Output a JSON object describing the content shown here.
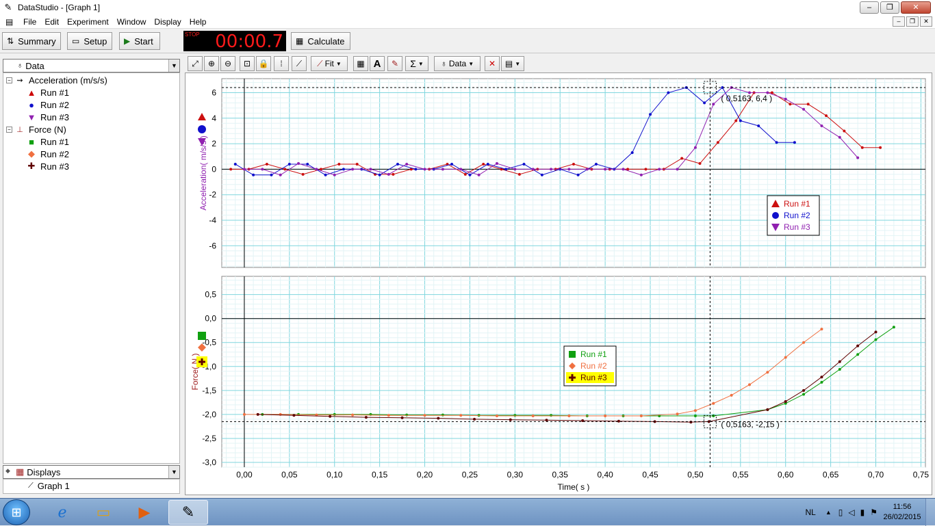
{
  "window": {
    "title": "DataStudio - [Graph 1]",
    "controls": [
      "–",
      "❐",
      "✕"
    ],
    "mdi_controls": [
      "–",
      "❐",
      "✕"
    ]
  },
  "menu": [
    "File",
    "Edit",
    "Experiment",
    "Window",
    "Display",
    "Help"
  ],
  "toolbar": {
    "summary_label": "Summary",
    "setup_label": "Setup",
    "start_label": "Start",
    "timer_stop_label": "STOP",
    "timer_value": "00:00.7",
    "calculate_label": "Calculate"
  },
  "data_panel": {
    "dropdown_label": "Data",
    "tree": [
      {
        "label": "Acceleration (m/s/s)",
        "level": 0,
        "symbol": "accel-sensor-icon"
      },
      {
        "label": "Run #1",
        "level": 1,
        "symbol": "triangle-up",
        "color": "#cc0000"
      },
      {
        "label": "Run #2",
        "level": 1,
        "symbol": "circle",
        "color": "#1010cc"
      },
      {
        "label": "Run #3",
        "level": 1,
        "symbol": "triangle-down",
        "color": "#9020b0"
      },
      {
        "label": "Force (N)",
        "level": 0,
        "symbol": "force-sensor-icon"
      },
      {
        "label": "Run #1",
        "level": 1,
        "symbol": "square",
        "color": "#10a010"
      },
      {
        "label": "Run #2",
        "level": 1,
        "symbol": "diamond",
        "color": "#f07040"
      },
      {
        "label": "Run #3",
        "level": 1,
        "symbol": "plus",
        "color": "#600000"
      }
    ],
    "displays_label": "Displays",
    "displays_items": [
      "Graph 1"
    ]
  },
  "graph_toolbar": {
    "fit_label": "Fit",
    "data_label": "Data"
  },
  "chart_data": [
    {
      "type": "line",
      "title": "",
      "xlabel": "",
      "ylabel": "Acceleration( m/s/s )",
      "xlim": [
        -0.025,
        0.755
      ],
      "ylim": [
        -7.7,
        7.1
      ],
      "yticks": [
        6,
        4,
        2,
        0,
        -2,
        -4,
        -6
      ],
      "legend": "bottom-right",
      "cursor_label": "( 0,5163, 6,4 )",
      "cursor": {
        "x": 0.5163,
        "y": 6.4
      },
      "series": [
        {
          "name": "Run #1",
          "color": "#cc1010",
          "x": [
            -0.015,
            0.005,
            0.025,
            0.045,
            0.065,
            0.085,
            0.105,
            0.125,
            0.145,
            0.165,
            0.185,
            0.205,
            0.225,
            0.245,
            0.265,
            0.285,
            0.305,
            0.325,
            0.345,
            0.365,
            0.385,
            0.405,
            0.425,
            0.445,
            0.465,
            0.485,
            0.505,
            0.525,
            0.545,
            0.565,
            0.585,
            0.605,
            0.625,
            0.645,
            0.665,
            0.685,
            0.705
          ],
          "y": [
            0,
            0,
            0.4,
            0,
            -0.4,
            0,
            0.4,
            0.4,
            -0.4,
            -0.4,
            0,
            0,
            0.4,
            -0.4,
            0.4,
            0,
            -0.4,
            0,
            0,
            0.4,
            0,
            0,
            0,
            0,
            0,
            0.85,
            0.45,
            2.1,
            3.8,
            6,
            6,
            5.1,
            5.1,
            4.2,
            3,
            1.7,
            1.7
          ]
        },
        {
          "name": "Run #2",
          "color": "#1010cc",
          "x": [
            -0.01,
            0.01,
            0.03,
            0.05,
            0.07,
            0.09,
            0.11,
            0.13,
            0.15,
            0.17,
            0.19,
            0.21,
            0.23,
            0.25,
            0.27,
            0.29,
            0.31,
            0.33,
            0.35,
            0.37,
            0.39,
            0.41,
            0.43,
            0.45,
            0.47,
            0.49,
            0.51,
            0.53,
            0.55,
            0.57,
            0.59,
            0.61
          ],
          "y": [
            0.4,
            -0.45,
            -0.45,
            0.4,
            0.4,
            -0.45,
            0,
            0,
            -0.45,
            0.4,
            0,
            0,
            0.4,
            -0.45,
            0.4,
            0,
            0.4,
            -0.45,
            0,
            -0.45,
            0.4,
            0,
            1.3,
            4.3,
            6,
            6.4,
            5.2,
            6.4,
            3.8,
            3.4,
            2.1,
            2.1
          ]
        },
        {
          "name": "Run #3",
          "color": "#9020b0",
          "x": [
            0,
            0.02,
            0.04,
            0.06,
            0.08,
            0.1,
            0.12,
            0.14,
            0.16,
            0.18,
            0.2,
            0.22,
            0.24,
            0.26,
            0.28,
            0.3,
            0.32,
            0.34,
            0.36,
            0.38,
            0.4,
            0.42,
            0.44,
            0.46,
            0.48,
            0.5,
            0.52,
            0.54,
            0.56,
            0.58,
            0.6,
            0.62,
            0.64,
            0.66,
            0.68
          ],
          "y": [
            0,
            0,
            -0.45,
            0.45,
            0,
            -0.45,
            0,
            0,
            -0.4,
            0.4,
            0,
            0,
            0,
            -0.45,
            0.45,
            0,
            0,
            0,
            0,
            0,
            0,
            0,
            -0.45,
            0,
            0,
            1.7,
            5.1,
            6.4,
            6,
            6,
            5.5,
            4.7,
            3.4,
            2.5,
            0.9
          ]
        }
      ]
    },
    {
      "type": "line",
      "title": "",
      "xlabel": "Time( s )",
      "ylabel": "Force( N )",
      "xlim": [
        -0.025,
        0.755
      ],
      "ylim": [
        -3.1,
        0.88
      ],
      "yticks": [
        0.5,
        0.0,
        -0.5,
        -1.0,
        -1.5,
        -2.0,
        -2.5,
        -3.0
      ],
      "ytick_labels": [
        "0,5",
        "0,0",
        "-0,5",
        "-1,0",
        "-1,5",
        "-2,0",
        "-2,5",
        "-3,0"
      ],
      "xticks": [
        0,
        0.05,
        0.1,
        0.15,
        0.2,
        0.25,
        0.3,
        0.35,
        0.4,
        0.45,
        0.5,
        0.55,
        0.6,
        0.65,
        0.7,
        0.75
      ],
      "xtick_labels": [
        "0,00",
        "0,05",
        "0,10",
        "0,15",
        "0,20",
        "0,25",
        "0,30",
        "0,35",
        "0,40",
        "0,45",
        "0,50",
        "0,55",
        "0,60",
        "0,65",
        "0,70",
        "0,75"
      ],
      "legend": "center",
      "cursor_label": "( 0,5163, -2,15 )",
      "cursor": {
        "x": 0.5163,
        "y": -2.15
      },
      "series": [
        {
          "name": "Run #1",
          "color": "#10a010",
          "x": [
            0.02,
            0.06,
            0.1,
            0.14,
            0.18,
            0.22,
            0.26,
            0.3,
            0.34,
            0.38,
            0.42,
            0.46,
            0.5,
            0.52,
            0.58,
            0.6,
            0.62,
            0.64,
            0.66,
            0.68,
            0.7,
            0.72
          ],
          "y": [
            -2.0,
            -2.0,
            -2.0,
            -2.0,
            -2.01,
            -2.01,
            -2.02,
            -2.02,
            -2.02,
            -2.03,
            -2.03,
            -2.03,
            -2.03,
            -2.03,
            -1.9,
            -1.77,
            -1.58,
            -1.33,
            -1.06,
            -0.75,
            -0.44,
            -0.18
          ]
        },
        {
          "name": "Run #2",
          "color": "#f07040",
          "x": [
            0,
            0.04,
            0.08,
            0.12,
            0.16,
            0.2,
            0.24,
            0.28,
            0.32,
            0.36,
            0.4,
            0.44,
            0.48,
            0.5,
            0.52,
            0.54,
            0.56,
            0.58,
            0.6,
            0.62,
            0.64
          ],
          "y": [
            -2.0,
            -2.0,
            -2.01,
            -2.01,
            -2.02,
            -2.02,
            -2.02,
            -2.03,
            -2.03,
            -2.03,
            -2.03,
            -2.03,
            -1.99,
            -1.92,
            -1.77,
            -1.6,
            -1.38,
            -1.12,
            -0.81,
            -0.5,
            -0.22
          ]
        },
        {
          "name": "Run #3",
          "color": "#600000",
          "x": [
            0.015,
            0.055,
            0.095,
            0.135,
            0.175,
            0.215,
            0.255,
            0.295,
            0.335,
            0.375,
            0.415,
            0.455,
            0.495,
            0.515,
            0.58,
            0.6,
            0.62,
            0.64,
            0.66,
            0.68,
            0.7
          ],
          "y": [
            -2.0,
            -2.02,
            -2.04,
            -2.06,
            -2.07,
            -2.08,
            -2.1,
            -2.11,
            -2.12,
            -2.13,
            -2.14,
            -2.15,
            -2.16,
            -2.15,
            -1.9,
            -1.73,
            -1.5,
            -1.22,
            -0.9,
            -0.57,
            -0.28
          ]
        }
      ]
    }
  ],
  "legend_top": [
    "Run #1",
    "Run #2",
    "Run #3"
  ],
  "legend_bottom": [
    "Run #1",
    "Run #2",
    "Run #3"
  ],
  "taskbar": {
    "lang": "NL",
    "time": "11:56",
    "date": "26/02/2015"
  }
}
